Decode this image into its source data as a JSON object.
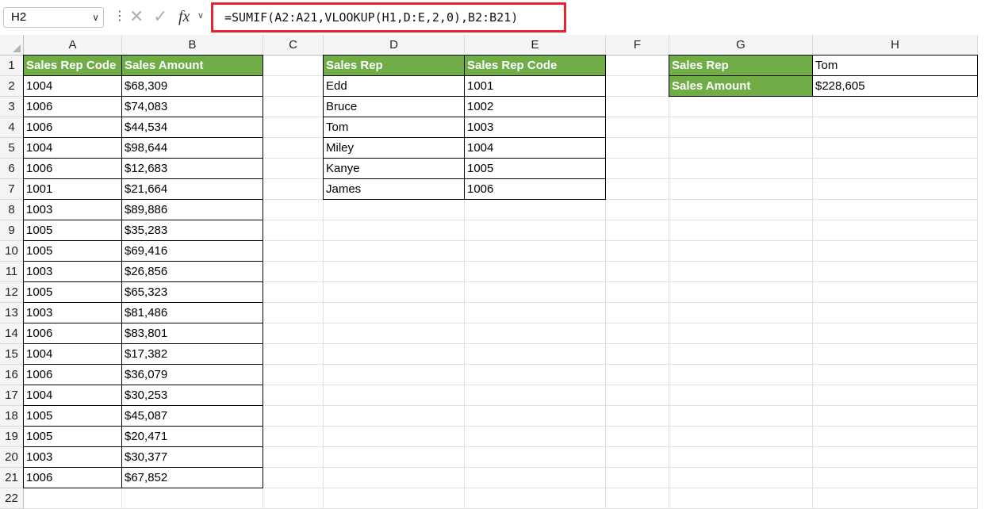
{
  "formula_bar": {
    "name_box": "H2",
    "formula": "=SUMIF(A2:A21,VLOOKUP(H1,D:E,2,0),B2:B21)"
  },
  "columns": [
    "A",
    "B",
    "C",
    "D",
    "E",
    "F",
    "G",
    "H"
  ],
  "rows": [
    "1",
    "2",
    "3",
    "4",
    "5",
    "6",
    "7",
    "8",
    "9",
    "10",
    "11",
    "12",
    "13",
    "14",
    "15",
    "16",
    "17",
    "18",
    "19",
    "20",
    "21",
    "22"
  ],
  "table1": {
    "headers": [
      "Sales Rep Code",
      "Sales Amount"
    ],
    "rows": [
      [
        "1004",
        "$68,309"
      ],
      [
        "1006",
        "$74,083"
      ],
      [
        "1006",
        "$44,534"
      ],
      [
        "1004",
        "$98,644"
      ],
      [
        "1006",
        "$12,683"
      ],
      [
        "1001",
        "$21,664"
      ],
      [
        "1003",
        "$89,886"
      ],
      [
        "1005",
        "$35,283"
      ],
      [
        "1005",
        "$69,416"
      ],
      [
        "1003",
        "$26,856"
      ],
      [
        "1005",
        "$65,323"
      ],
      [
        "1003",
        "$81,486"
      ],
      [
        "1006",
        "$83,801"
      ],
      [
        "1004",
        "$17,382"
      ],
      [
        "1006",
        "$36,079"
      ],
      [
        "1004",
        "$30,253"
      ],
      [
        "1005",
        "$45,087"
      ],
      [
        "1005",
        "$20,471"
      ],
      [
        "1003",
        "$30,377"
      ],
      [
        "1006",
        "$67,852"
      ]
    ]
  },
  "table2": {
    "headers": [
      "Sales Rep",
      "Sales Rep Code"
    ],
    "rows": [
      [
        "Edd",
        "1001"
      ],
      [
        "Bruce",
        "1002"
      ],
      [
        "Tom",
        "1003"
      ],
      [
        "Miley",
        "1004"
      ],
      [
        "Kanye",
        "1005"
      ],
      [
        "James",
        "1006"
      ]
    ]
  },
  "lookup": {
    "rows": [
      {
        "label": "Sales Rep",
        "value": "Tom"
      },
      {
        "label": "Sales Amount",
        "value": "$228,605"
      }
    ]
  },
  "colors": {
    "header_fill": "#70ad47",
    "formula_highlight": "#e3262d"
  }
}
